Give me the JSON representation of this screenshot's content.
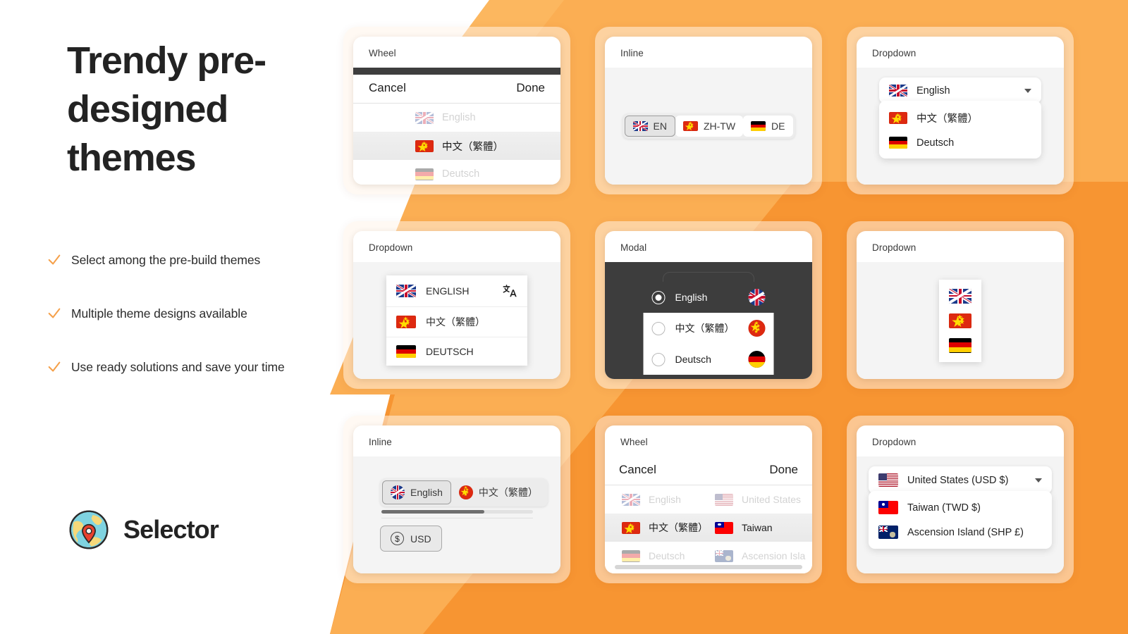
{
  "hero": {
    "headline": "Trendy pre-designed themes",
    "features": [
      "Select among the pre-build themes",
      "Multiple theme designs available",
      "Use ready solutions and save your time"
    ],
    "brand_name": "Selector",
    "brand_icon": "globe-pin-icon"
  },
  "colors": {
    "orange_main": "#F79532",
    "orange_light": "#FBAE53",
    "accent_check": "#F5A04A",
    "text_dark": "#232323",
    "modal_dark": "#3D3D3D"
  },
  "cards": [
    {
      "title": "Wheel",
      "type": "wheel",
      "actions": {
        "cancel": "Cancel",
        "done": "Done"
      },
      "rows": [
        {
          "label": "English",
          "flag": "uk-flag",
          "state": "dim"
        },
        {
          "label": "中文（繁體）",
          "flag": "china-flag",
          "state": "selected"
        },
        {
          "label": "Deutsch",
          "flag": "germany-flag",
          "state": "dim"
        }
      ]
    },
    {
      "title": "Inline",
      "type": "segmented",
      "items": [
        {
          "label": "EN",
          "flag": "uk-flag",
          "state": "selected"
        },
        {
          "label": "ZH-TW",
          "flag": "china-flag",
          "state": "normal"
        },
        {
          "label": "DE",
          "flag": "germany-flag",
          "state": "normal"
        }
      ]
    },
    {
      "title": "Dropdown",
      "type": "dropdown",
      "selected": {
        "label": "English",
        "flag": "uk-flag"
      },
      "options": [
        {
          "label": "中文（繁體）",
          "flag": "china-flag"
        },
        {
          "label": "Deutsch",
          "flag": "germany-flag"
        }
      ]
    },
    {
      "title": "Dropdown",
      "type": "dropdown-panel",
      "items": [
        {
          "label": "ENGLISH",
          "flag": "uk-flag",
          "icon": "translate-icon"
        },
        {
          "label": "中文（繁體）",
          "flag": "china-flag"
        },
        {
          "label": "DEUTSCH",
          "flag": "germany-flag"
        }
      ]
    },
    {
      "title": "Modal",
      "type": "modal-radio",
      "rows": [
        {
          "label": "English",
          "flag": "uk-flag",
          "state": "selected"
        },
        {
          "label": "中文（繁體）",
          "flag": "china-flag",
          "state": "normal"
        },
        {
          "label": "Deutsch",
          "flag": "germany-flag",
          "state": "normal"
        }
      ]
    },
    {
      "title": "Dropdown",
      "type": "dropdown-flags",
      "items": [
        {
          "flag": "uk-flag"
        },
        {
          "flag": "china-flag"
        },
        {
          "flag": "germany-flag"
        }
      ]
    },
    {
      "title": "Inline",
      "type": "segmented-currency",
      "items": [
        {
          "label": "English",
          "flag": "uk-flag",
          "state": "selected"
        },
        {
          "label": "中文（繁體）",
          "flag": "china-flag-circle",
          "state": "normal"
        }
      ],
      "currency": {
        "label": "USD",
        "icon": "dollar-coin-icon"
      }
    },
    {
      "title": "Wheel",
      "type": "wheel-two-column",
      "actions": {
        "cancel": "Cancel",
        "done": "Done"
      },
      "rows": [
        {
          "language": {
            "label": "English",
            "flag": "uk-flag"
          },
          "country": {
            "label": "United States",
            "flag": "usa-flag"
          },
          "state": "dim"
        },
        {
          "language": {
            "label": "中文（繁體）",
            "flag": "china-flag"
          },
          "country": {
            "label": "Taiwan",
            "flag": "taiwan-flag"
          },
          "state": "selected"
        },
        {
          "language": {
            "label": "Deutsch",
            "flag": "germany-flag"
          },
          "country": {
            "label": "Ascension Isla",
            "flag": "ascension-flag"
          },
          "state": "dim"
        }
      ]
    },
    {
      "title": "Dropdown",
      "type": "dropdown-currency",
      "selected": {
        "label": "United States (USD $)",
        "flag": "usa-flag"
      },
      "options": [
        {
          "label": "Taiwan (TWD $)",
          "flag": "taiwan-flag"
        },
        {
          "label": "Ascension Island (SHP £)",
          "flag": "ascension-flag"
        }
      ]
    }
  ]
}
